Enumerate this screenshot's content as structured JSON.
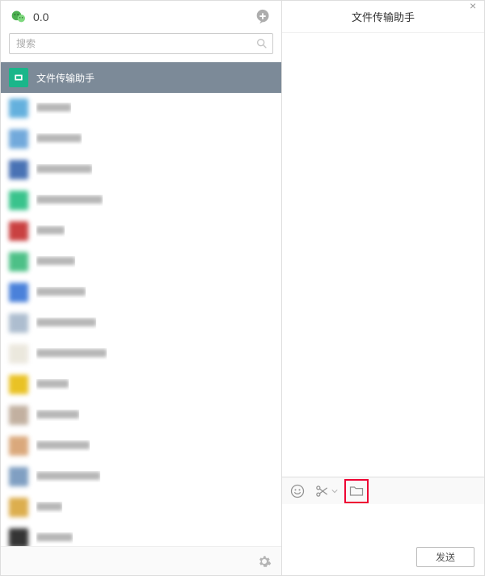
{
  "header": {
    "username": "0.0"
  },
  "search": {
    "placeholder": "搜索"
  },
  "chats": [
    {
      "name": "文件传输助手",
      "avatar_color": "#1ab68a",
      "active": true
    },
    {
      "name": "",
      "avatar_color": "#4aa3d8"
    },
    {
      "name": "",
      "avatar_color": "#5a9bd5"
    },
    {
      "name": "",
      "avatar_color": "#2a5aa8"
    },
    {
      "name": "",
      "avatar_color": "#17b978"
    },
    {
      "name": "",
      "avatar_color": "#c02020"
    },
    {
      "name": "",
      "avatar_color": "#2fb673"
    },
    {
      "name": "",
      "avatar_color": "#2b6cd4"
    },
    {
      "name": "",
      "avatar_color": "#9fb2c7"
    },
    {
      "name": "",
      "avatar_color": "#e8e4d8"
    },
    {
      "name": "",
      "avatar_color": "#e6b800"
    },
    {
      "name": "",
      "avatar_color": "#b8a390"
    },
    {
      "name": "",
      "avatar_color": "#d49a66"
    },
    {
      "name": "",
      "avatar_color": "#6a8fb8"
    },
    {
      "name": "",
      "avatar_color": "#d6a030"
    },
    {
      "name": "",
      "avatar_color": "#111111"
    }
  ],
  "conversation": {
    "title": "文件传输助手"
  },
  "send": {
    "label": "发送"
  },
  "icons": {
    "emoji": "emoji-icon",
    "scissors": "scissors-icon",
    "folder": "folder-icon"
  }
}
